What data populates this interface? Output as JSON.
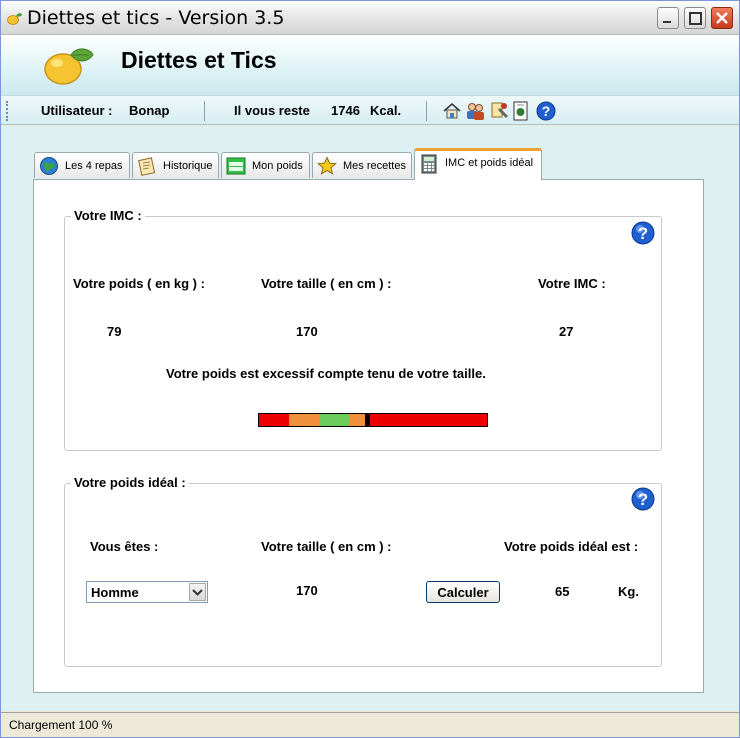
{
  "window": {
    "title": "Diettes et tics - Version 3.5"
  },
  "header": {
    "app_name": "Diettes et Tics"
  },
  "toolbar": {
    "user_label": "Utilisateur :",
    "user_name": "Bonap",
    "remaining_label": "Il vous reste",
    "remaining_value": "1746",
    "remaining_unit": "Kcal.",
    "icons": [
      "home-icon",
      "users-icon",
      "tools-icon",
      "document-icon",
      "help-icon"
    ]
  },
  "tabs": [
    {
      "label": "Les 4 repas",
      "icon": "globe-icon"
    },
    {
      "label": "Historique",
      "icon": "notepad-icon"
    },
    {
      "label": "Mon poids",
      "icon": "weight-icon"
    },
    {
      "label": "Mes recettes",
      "icon": "star-icon"
    },
    {
      "label": "IMC et poids idéal",
      "icon": "calculator-icon",
      "active": true
    }
  ],
  "imc": {
    "legend": "Votre IMC  :",
    "weight_label": "Votre poids ( en kg ) :",
    "height_label": "Votre taille ( en cm ) :",
    "imc_label": "Votre IMC :",
    "weight_value": "79",
    "height_value": "170",
    "imc_value": "27",
    "message": "Votre poids est excessif compte tenu de votre taille.",
    "bar_colors": {
      "red": "#ee0000",
      "orange": "#f0903c",
      "green": "#6ccc5c",
      "marker": "#000000"
    }
  },
  "ideal": {
    "legend": "Votre poids idéal :",
    "sex_label": "Vous êtes :",
    "height_label": "Votre taille ( en cm ) :",
    "result_label": "Votre poids idéal est :",
    "sex_value": "Homme",
    "height_value": "170",
    "calc_button": "Calculer",
    "result_value": "65",
    "result_unit": "Kg."
  },
  "status": {
    "text": "Chargement 100 %"
  }
}
